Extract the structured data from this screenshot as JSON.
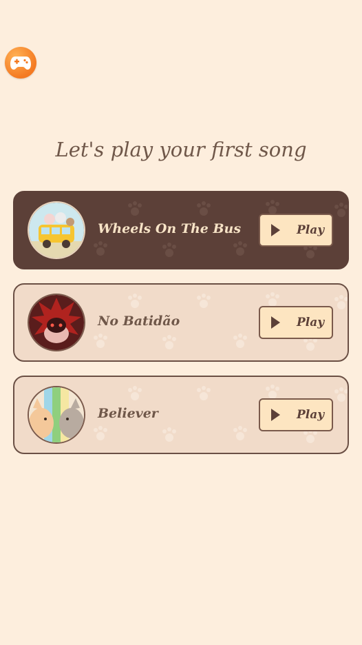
{
  "header": {
    "title": "Let's play your first song"
  },
  "songs": [
    {
      "name": "Wheels On The Bus",
      "play_label": "Play",
      "cover": "school-bus-cats-cover"
    },
    {
      "name": "No Batidão",
      "play_label": "Play",
      "cover": "red-spiky-cat-cover"
    },
    {
      "name": "Believer",
      "play_label": "Play",
      "cover": "two-cats-cover"
    }
  ],
  "icons": {
    "game": "gamepad-icon",
    "play": "play-icon",
    "paw": "paw-icon"
  },
  "colors": {
    "background": "#fdeedd",
    "card": "#f1dbc9",
    "card_active": "#5c4038",
    "button": "#fde5c1",
    "accent": "#f47a22"
  }
}
